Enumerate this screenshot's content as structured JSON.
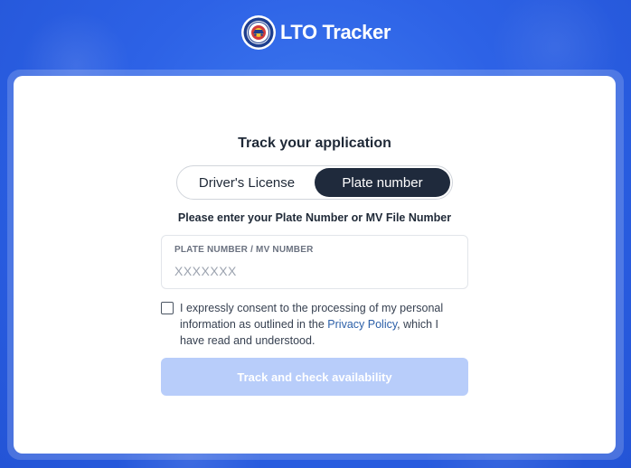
{
  "header": {
    "brand_name": "LTO Tracker",
    "logo_icon": "lto-seal-icon"
  },
  "form": {
    "title": "Track your application",
    "tabs": [
      {
        "label": "Driver's License",
        "selected": false
      },
      {
        "label": "Plate number",
        "selected": true
      }
    ],
    "instruction": "Please enter your Plate Number or MV File Number",
    "field_label": "PLATE NUMBER / MV NUMBER",
    "field_value": "",
    "field_placeholder": "XXXXXXX",
    "consent": {
      "checked": false,
      "text_before": "I expressly consent to the processing of my personal information as outlined in the ",
      "link_text": "Privacy Policy",
      "text_after": ", which I have read and understood."
    },
    "submit_label": "Track and check availability",
    "submit_disabled": true
  },
  "colors": {
    "background": "#2d62e6",
    "toggle_active": "#1f2a3c",
    "button_disabled": "#b8cdfa",
    "link": "#2b5fa8"
  }
}
